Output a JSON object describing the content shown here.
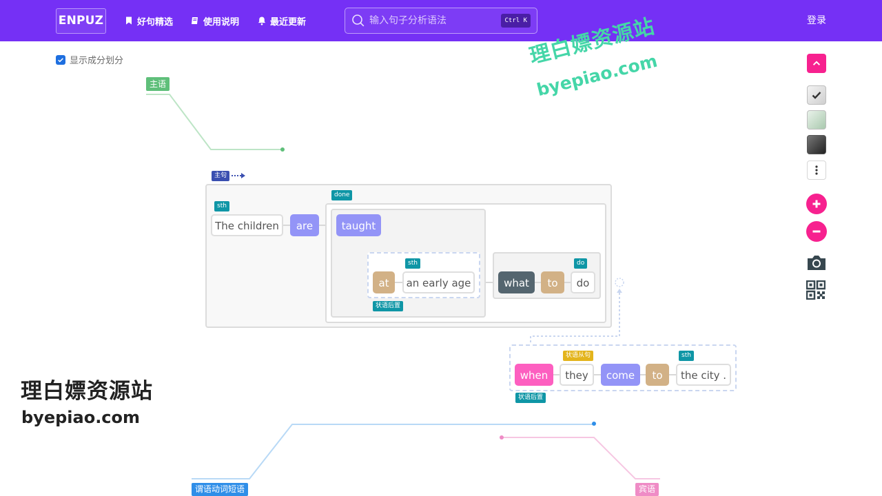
{
  "header": {
    "logo": "ENPUZ",
    "nav": [
      {
        "label": "好句精选",
        "icon": "bookmark-icon"
      },
      {
        "label": "使用说明",
        "icon": "book-icon"
      },
      {
        "label": "最近更新",
        "icon": "bell-icon"
      }
    ],
    "search": {
      "placeholder": "输入句子分析语法",
      "shortcut": "Ctrl K"
    },
    "login_label": "登录"
  },
  "options": {
    "show_components_label": "显示成分划分",
    "show_components_checked": true
  },
  "diagram": {
    "labels": {
      "subject": "主语",
      "main_clause": "主句",
      "predicate_phrase": "谓语动词短语",
      "object": "宾语"
    },
    "tags": {
      "sth_1": "sth",
      "done": "done",
      "sth_2": "sth",
      "postposed_adverbial_1": "状语后置",
      "do": "do",
      "adverbial_clause": "状语从句",
      "sth_3": "sth",
      "postposed_adverbial_2": "状语后置"
    },
    "words": {
      "the_children": "The children",
      "are": "are",
      "taught": "taught",
      "at": "at",
      "an_early_age": "an early age",
      "what": "what",
      "to_1": "to",
      "do": "do",
      "when": "when",
      "they": "they",
      "come": "come",
      "to_2": "to",
      "the_city": "the city ."
    },
    "colors": {
      "subject": "#5fbf7a",
      "predicate": "#2f8ee8",
      "object": "#ef8cc6",
      "tag_teal": "#0f96a6",
      "word_purple": "#9394f7",
      "word_tan": "#d2b186",
      "word_slate": "#54656f",
      "word_pink": "#fd5fc0"
    }
  },
  "toolbar": {
    "items": [
      "scroll-top-icon",
      "check-theme-icon",
      "green-theme-icon",
      "dark-theme-icon",
      "more-icon",
      "zoom-in-icon",
      "zoom-out-icon",
      "camera-icon",
      "qr-code-icon"
    ],
    "accent": "#f7218f"
  },
  "watermark": {
    "title": "理白嫖资源站",
    "url": "byepiao.com"
  }
}
